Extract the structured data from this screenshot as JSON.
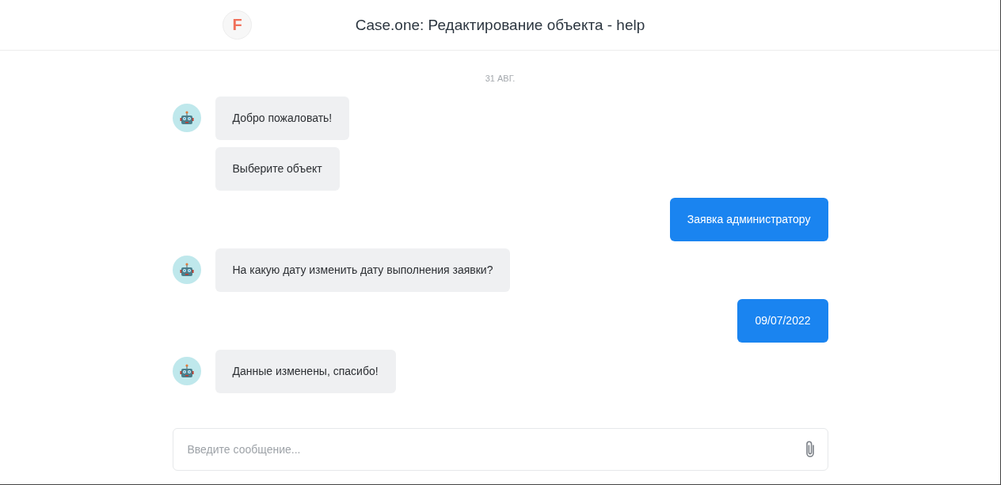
{
  "header": {
    "logo_letter": "F",
    "title": "Case.one: Редактирование объекта - help"
  },
  "date_divider": "31 АВГ.",
  "message_groups": [
    {
      "kind": "bot",
      "messages": [
        "Добро пожаловать!",
        "Выберите объект"
      ]
    },
    {
      "kind": "user",
      "messages": [
        "Заявка администратору"
      ]
    },
    {
      "kind": "bot",
      "messages": [
        "На какую дату изменить дату выполнения заявки?"
      ]
    },
    {
      "kind": "user",
      "messages": [
        "09/07/2022"
      ]
    },
    {
      "kind": "bot",
      "messages": [
        "Данные изменены, спасибо!"
      ]
    }
  ],
  "composer": {
    "placeholder": "Введите сообщение..."
  }
}
